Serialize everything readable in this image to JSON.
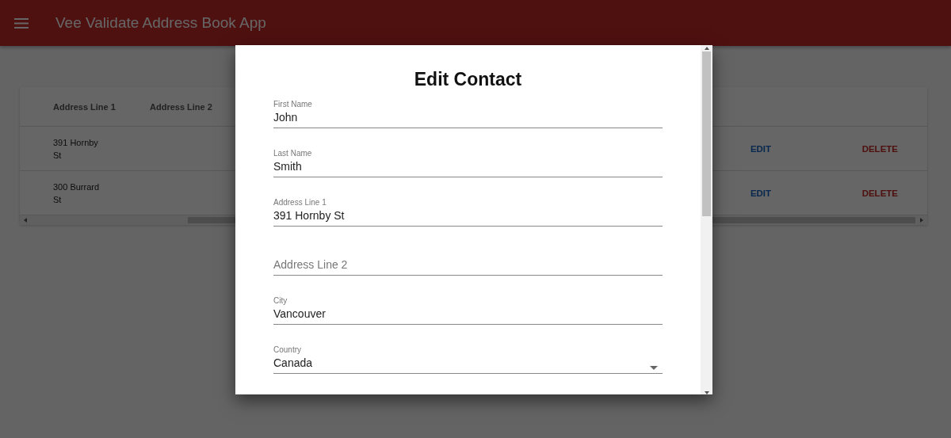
{
  "app_bar": {
    "title": "Vee Validate Address Book App"
  },
  "table": {
    "columns": [
      "Address Line 1",
      "Address Line 2"
    ],
    "rows": [
      {
        "address_line_1": "391 Hornby St",
        "actions": [
          "EDIT",
          "DELETE"
        ]
      },
      {
        "address_line_1": "300 Burrard St",
        "actions": [
          "EDIT",
          "DELETE"
        ]
      }
    ]
  },
  "dialog": {
    "title": "Edit Contact",
    "fields": [
      {
        "kind": "text",
        "label": "First Name",
        "value": "John"
      },
      {
        "kind": "text",
        "label": "Last Name",
        "value": "Smith"
      },
      {
        "kind": "text",
        "label": "Address Line 1",
        "value": "391 Hornby St"
      },
      {
        "kind": "text",
        "placeholder": "Address Line 2"
      },
      {
        "kind": "text",
        "label": "City",
        "value": "Vancouver"
      },
      {
        "kind": "select",
        "label": "Country",
        "value": "Canada"
      }
    ]
  }
}
